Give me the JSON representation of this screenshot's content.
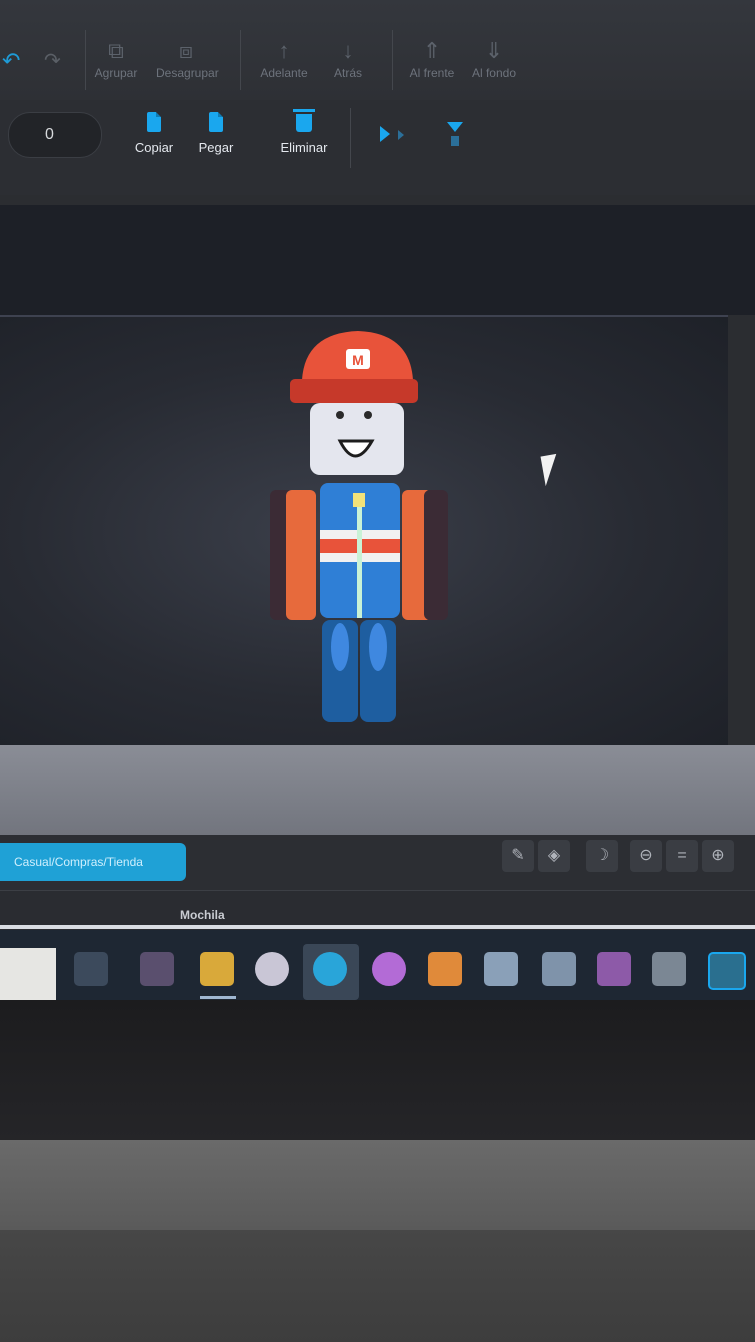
{
  "ribbon": {
    "groups": [
      {
        "label": "Agrupar"
      },
      {
        "label": "Desagrupar"
      },
      {
        "label": "Adelante"
      },
      {
        "label": "Atrás"
      },
      {
        "label": "Al frente"
      },
      {
        "label": "Al fondo"
      }
    ],
    "number_field_value": "0",
    "actions": [
      {
        "label": "Copiar",
        "icon": "copy-icon"
      },
      {
        "label": "Pegar",
        "icon": "paste-icon"
      },
      {
        "label": "Eliminar",
        "icon": "delete-icon"
      }
    ]
  },
  "viewport": {
    "character_logo_text": "M"
  },
  "bottom_bar": {
    "toggle_label": "Casual/Compras/Tienda"
  },
  "tabs": {
    "active_tab": "Mochila"
  },
  "colors": {
    "accent": "#1aa7ee",
    "hat": "#e8533a",
    "torso": "#2f7fd6",
    "arms": "#e76a3c"
  }
}
